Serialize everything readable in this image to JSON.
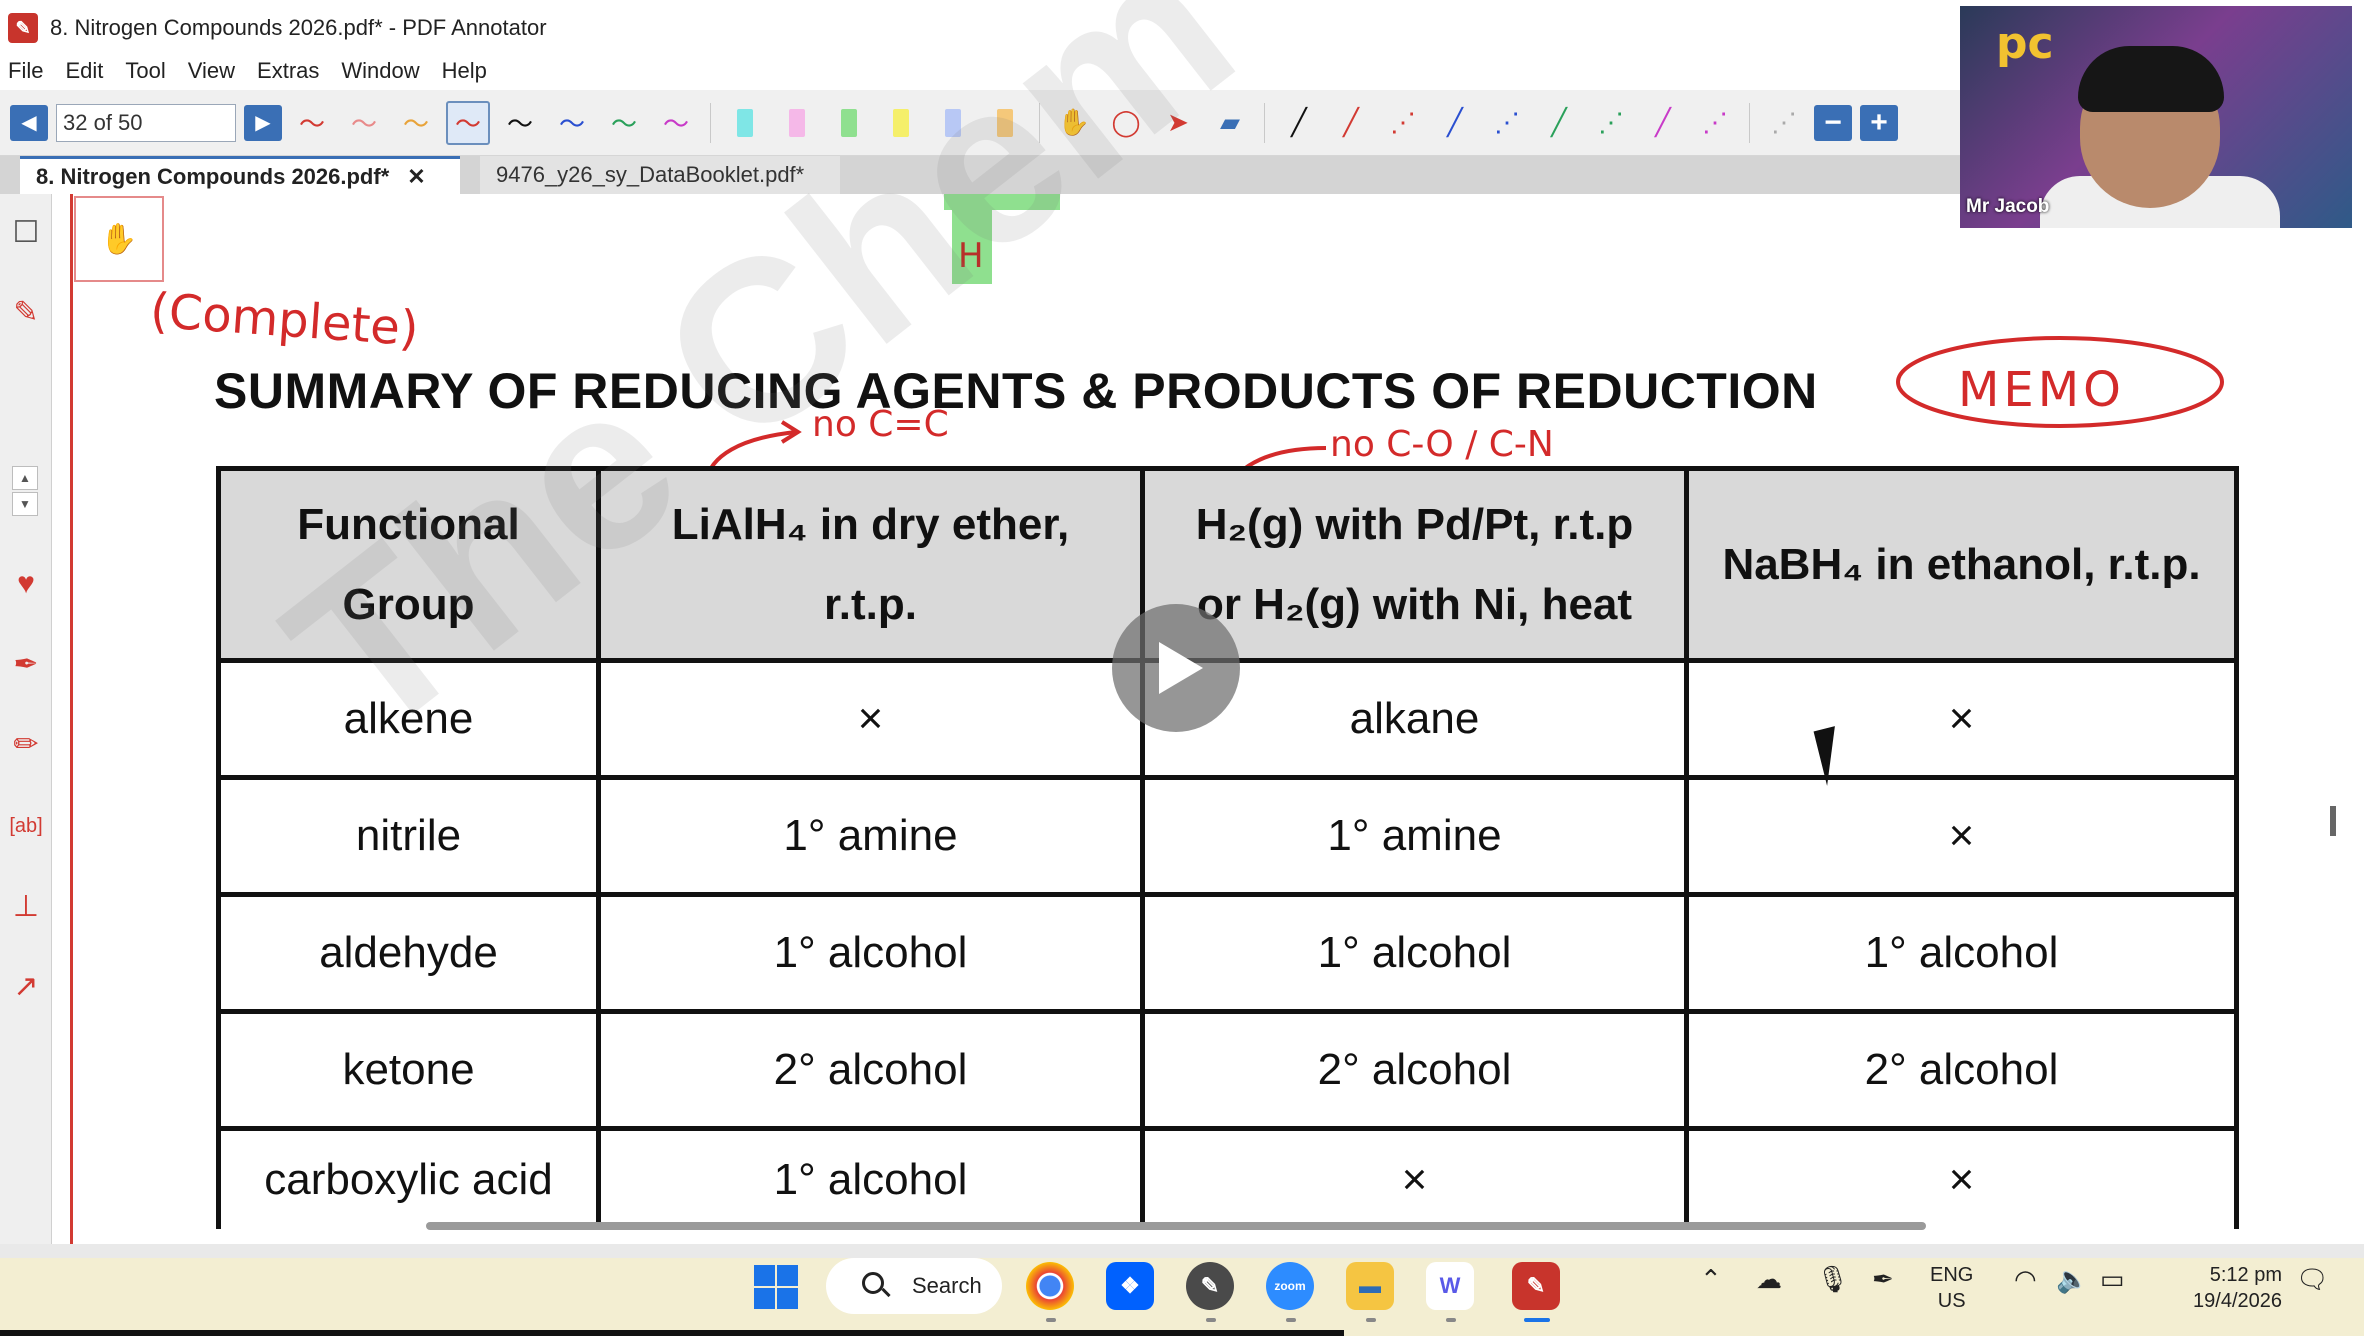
{
  "window": {
    "title": "8. Nitrogen Compounds 2026.pdf* - PDF Annotator"
  },
  "menu": [
    "File",
    "Edit",
    "Tool",
    "View",
    "Extras",
    "Window",
    "Help"
  ],
  "toolbar": {
    "page_indicator": "32 of 50"
  },
  "tabs": [
    {
      "label": "8. Nitrogen Compounds 2026.pdf*",
      "close": "✕"
    },
    {
      "label": "9476_y26_sy_DataBooklet.pdf*"
    }
  ],
  "document": {
    "title": "SUMMARY OF REDUCING AGENTS & PRODUCTS OF REDUCTION",
    "residual_mark": "H",
    "table": {
      "headers": [
        {
          "line1": "Functional",
          "line2": "Group"
        },
        {
          "line1": "LiAlH₄ in dry ether,",
          "line2": "r.t.p."
        },
        {
          "line1": "H₂(g) with Pd/Pt, r.t.p",
          "line2": "or H₂(g) with Ni, heat"
        },
        {
          "line1": "NaBH₄ in ethanol, r.t.p.",
          "line2": ""
        }
      ],
      "rows": [
        [
          "alkene",
          "×",
          "alkane",
          "×"
        ],
        [
          "nitrile",
          "1° amine",
          "1° amine",
          "×"
        ],
        [
          "aldehyde",
          "1° alcohol",
          "1° alcohol",
          "1° alcohol"
        ],
        [
          "ketone",
          "2° alcohol",
          "2° alcohol",
          "2° alcohol"
        ],
        [
          "carboxylic acid",
          "1° alcohol",
          "×",
          "×"
        ]
      ]
    }
  },
  "annotations": {
    "complete": "(Complete)",
    "memo": "MEMO",
    "no_cc": "no C=C",
    "no_co_cn": "no C-O / C-N"
  },
  "watermark": "The Chem",
  "webcam": {
    "label": "Mr Jacob",
    "logo": "pc"
  },
  "taskbar": {
    "search_label": "Search",
    "language_line1": "ENG",
    "language_line2": "US",
    "time": "5:12 pm",
    "date": "19/4/2026"
  },
  "colors": {
    "annotation_red": "#d32a2a",
    "accent_blue": "#3a6fb5",
    "table_header_gray": "#d9d9d9"
  }
}
